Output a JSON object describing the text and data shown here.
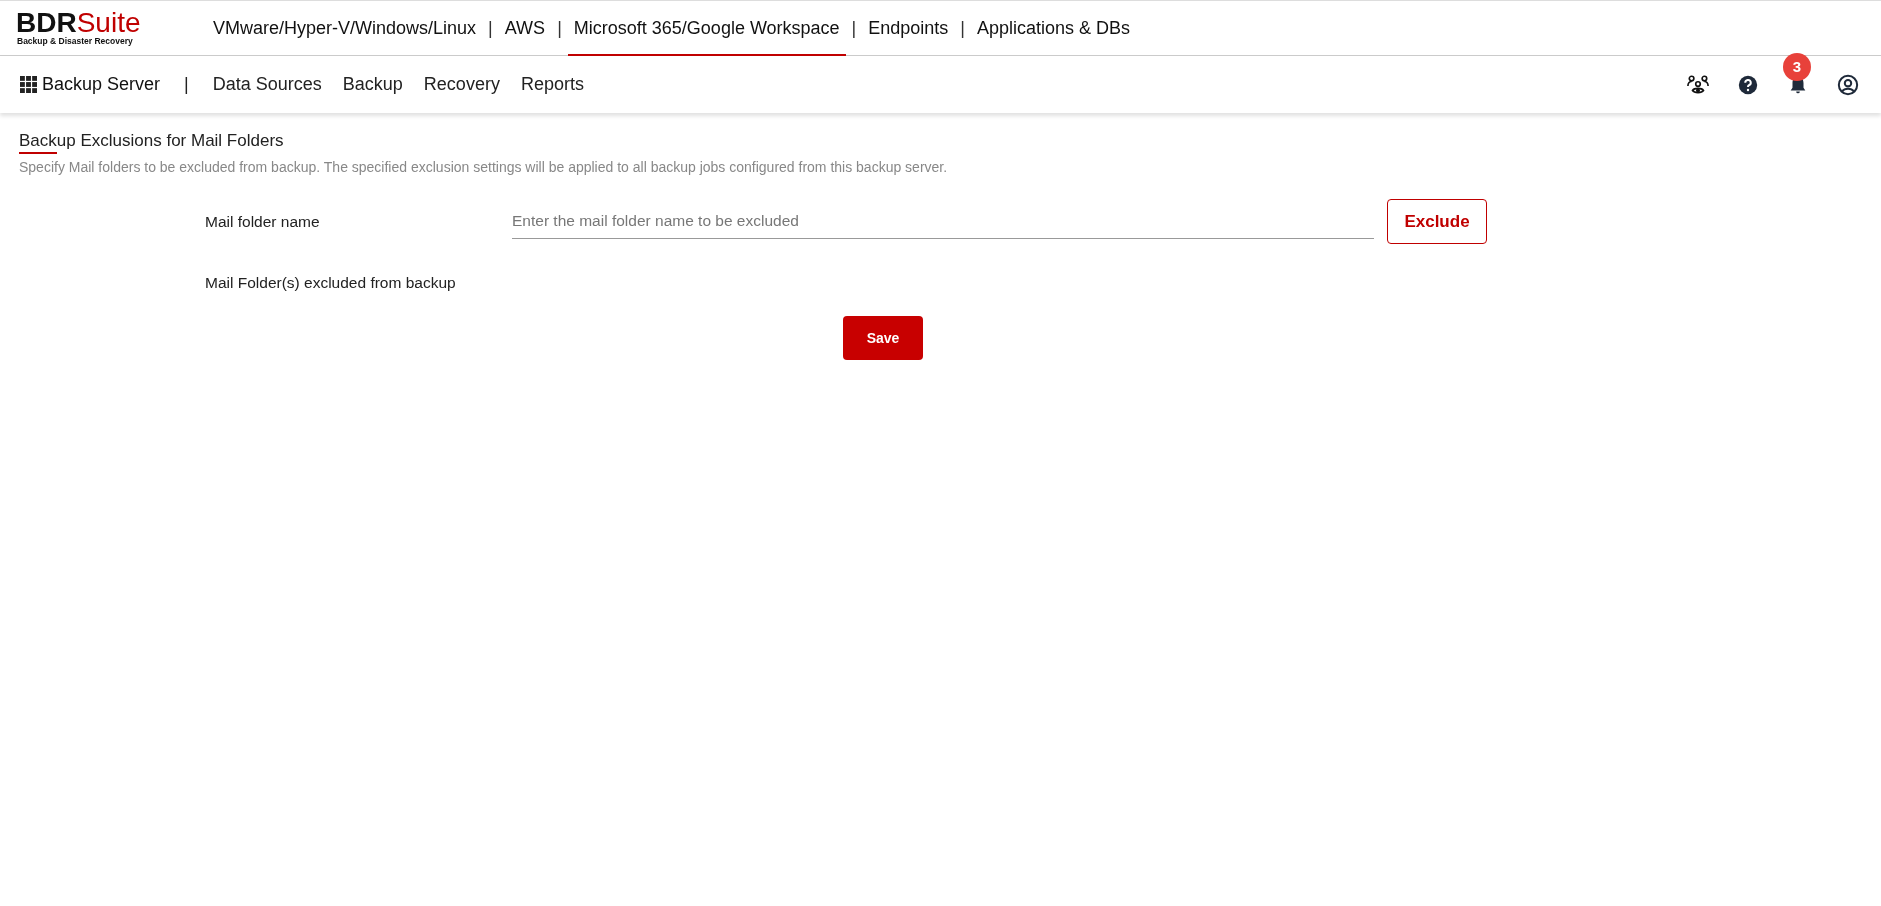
{
  "brand": {
    "name_dark": "BDR",
    "name_accent": "Suite",
    "tagline": "Backup & Disaster Recovery"
  },
  "top_nav": [
    {
      "label": "VMware/Hyper-V/Windows/Linux",
      "selected": false,
      "separator": "|"
    },
    {
      "label": "AWS",
      "selected": false,
      "separator": "|"
    },
    {
      "label": "Microsoft 365/Google Workspace",
      "selected": true,
      "separator": "|"
    },
    {
      "label": "Endpoints",
      "selected": false,
      "separator": "|"
    },
    {
      "label": "Applications & DBs",
      "selected": false
    }
  ],
  "sub_nav": {
    "title": "Backup Server",
    "separator": "|",
    "items": [
      "Data Sources",
      "Backup",
      "Recovery",
      "Reports"
    ]
  },
  "notifications": {
    "count": "3"
  },
  "page": {
    "title": "Backup Exclusions for Mail Folders",
    "description": "Specify Mail folders to be excluded from backup. The specified exclusion settings will be applied to all backup jobs configured from this backup server."
  },
  "form": {
    "folder_label": "Mail folder name",
    "folder_placeholder": "Enter the mail folder name to be excluded",
    "exclude_button": "Exclude",
    "excluded_label": "Mail Folder(s) excluded from backup",
    "save_button": "Save"
  }
}
